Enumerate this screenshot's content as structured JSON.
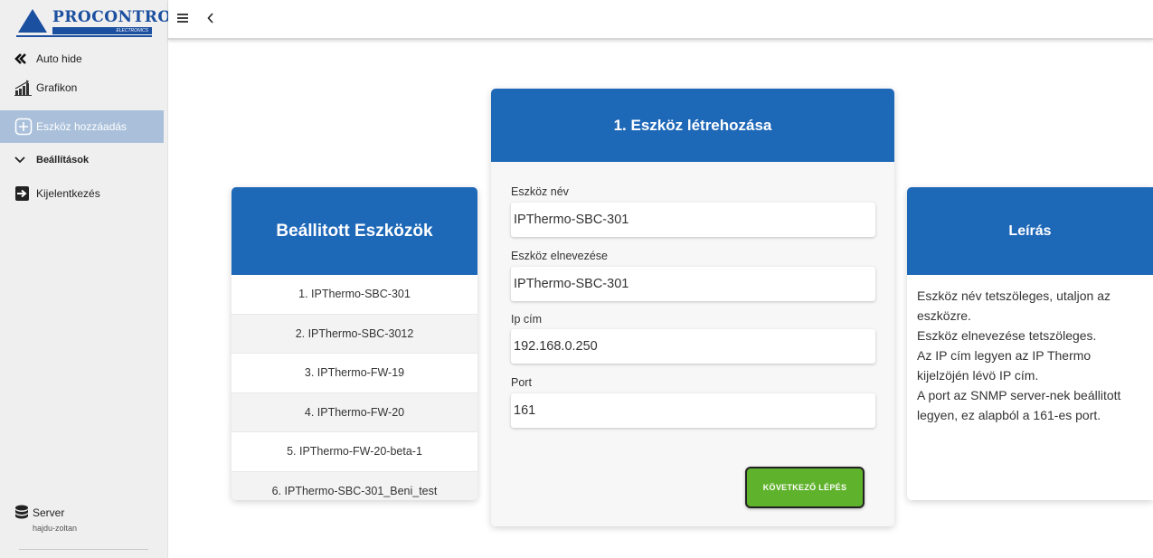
{
  "brand": {
    "name": "PROCONTROL",
    "sub": "ELECTRONICS"
  },
  "sidebar": {
    "items": [
      {
        "label": "Auto hide",
        "icon": "double-chevron-left-icon"
      },
      {
        "label": "Grafikon",
        "icon": "chart-icon"
      },
      {
        "label": "Eszköz hozzáadás",
        "icon": "plus-square-icon",
        "active": true
      },
      {
        "label": "Beállítások",
        "icon": "chevron-down-icon"
      },
      {
        "label": "Kijelentkezés",
        "icon": "logout-icon"
      }
    ],
    "server": {
      "title": "Server",
      "user": "hajdu-zoltan",
      "icon": "database-icon"
    }
  },
  "topbar": {
    "menu_icon": "menu-icon",
    "back_icon": "chevron-left-icon"
  },
  "devices": {
    "title": "Beállitott Eszközök",
    "items": [
      "1. IPThermo-SBC-301",
      "2. IPThermo-SBC-3012",
      "3. IPThermo-FW-19",
      "4. IPThermo-FW-20",
      "5. IPThermo-FW-20-beta-1",
      "6. IPThermo-SBC-301_Beni_test"
    ]
  },
  "form": {
    "title": "1. Eszköz létrehozása",
    "fields": [
      {
        "label": "Eszköz név",
        "value": "IPThermo-SBC-301"
      },
      {
        "label": "Eszköz elnevezése",
        "value": "IPThermo-SBC-301"
      },
      {
        "label": "Ip cím",
        "value": "192.168.0.250"
      },
      {
        "label": "Port",
        "value": "161"
      }
    ],
    "next_label": "KÖVETKEZŐ LÉPÉS"
  },
  "description": {
    "title": "Leírás",
    "lines": [
      "Eszköz név tetszöleges, utaljon az",
      "eszközre.",
      "Eszköz elnevezése tetszöleges.",
      "Az IP cím legyen az IP Thermo",
      "kijelzöjén lévö IP cím.",
      "A port az SNMP server-nek beállitott",
      "legyen, ez alapból a 161-es port."
    ]
  },
  "colors": {
    "primary": "#1e68b8",
    "success": "#5fb22b",
    "sidebar_active": "#a9bfda"
  }
}
